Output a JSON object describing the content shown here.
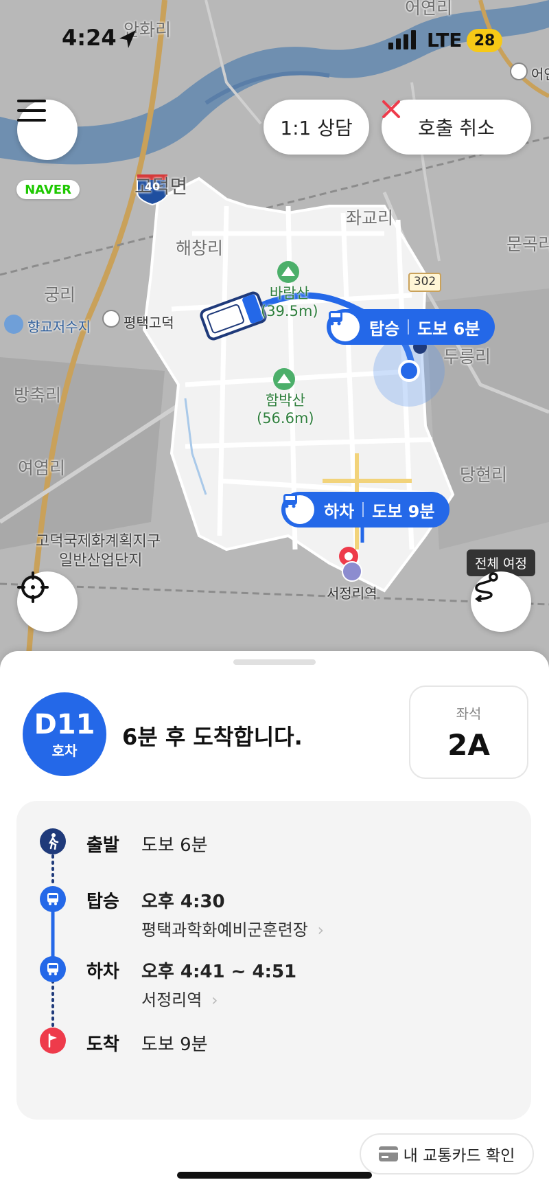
{
  "status_bar": {
    "time": "4:24",
    "network": "LTE",
    "battery": "28"
  },
  "top_actions": {
    "consult_label": "1:1 상담",
    "cancel_label": "호출 취소"
  },
  "map": {
    "naver_logo": "NAVER",
    "highway_number": "40",
    "route_number": "302",
    "labels": {
      "ahwari": "안화리",
      "eodeul": "어연리",
      "goduk_myeon": "고덕면",
      "haechangri": "해창리",
      "jwagyori": "좌교리",
      "mungokri": "문곡리",
      "gungri": "궁리",
      "hyanggyo": "향교저수지",
      "pyeongtaek_goduk": "평택고덕",
      "dureungri": "두릉리",
      "bangchukri": "방축리",
      "danghyeonri": "당현리",
      "yeoyeomri": "여염리",
      "industrial_1": "고덕국제화계획지구",
      "industrial_2": "일반산업단지",
      "station": "서정리역",
      "ic_top": "어연"
    },
    "mountains": [
      {
        "name": "바람산",
        "height": "(39.5m)"
      },
      {
        "name": "함박산",
        "height": "(56.6m)"
      }
    ],
    "board_bubble": {
      "label": "탑승",
      "detail": "도보 6분"
    },
    "alight_bubble": {
      "label": "하차",
      "detail": "도보 9분"
    },
    "full_trip_tooltip": "전체 여정"
  },
  "sheet": {
    "bus_code": "D11",
    "bus_unit": "호차",
    "arrival_message": "6분 후 도착합니다.",
    "seat_label": "좌석",
    "seat_value": "2A",
    "steps": [
      {
        "label": "출발",
        "value": "도보 6분",
        "sub": ""
      },
      {
        "label": "탑승",
        "value": "오후 4:30",
        "sub": "평택과학화예비군훈련장"
      },
      {
        "label": "하차",
        "value": "오후 4:41 ~ 4:51",
        "sub": "서정리역"
      },
      {
        "label": "도착",
        "value": "도보 9분",
        "sub": ""
      }
    ],
    "transit_card_label": "내 교통카드 확인"
  },
  "colors": {
    "primary": "#2468e8",
    "dark_navy": "#1f3a7a",
    "danger": "#ee3b4b"
  }
}
